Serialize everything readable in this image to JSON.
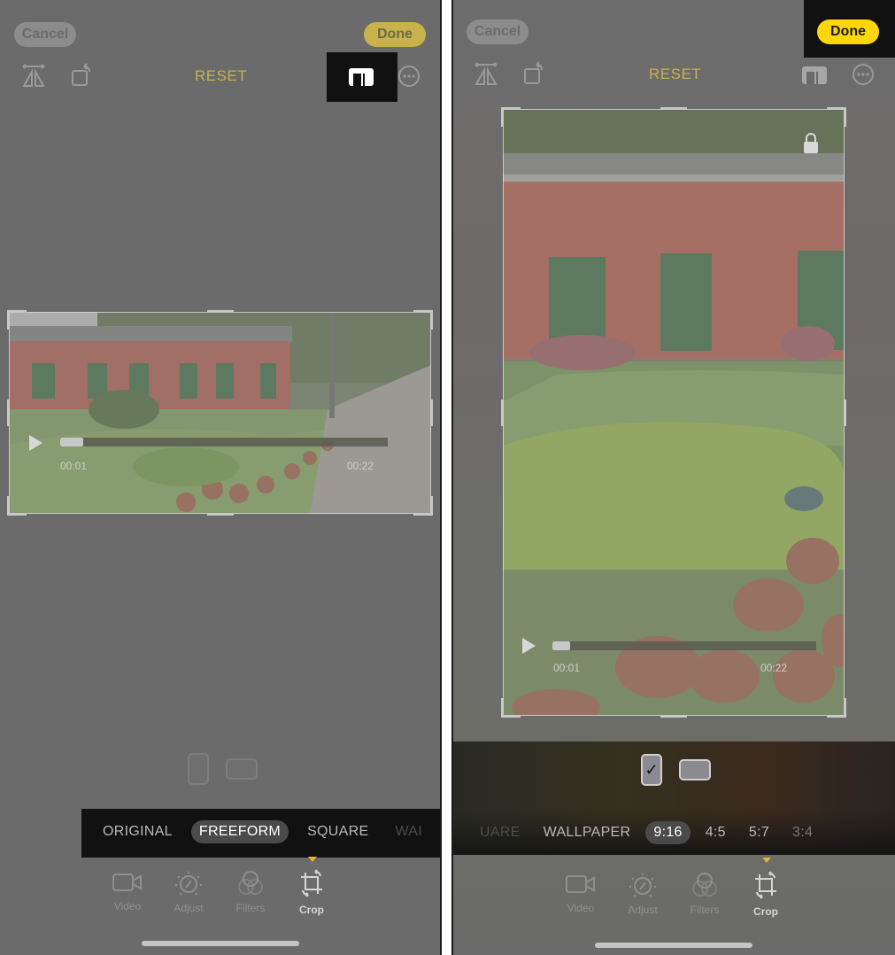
{
  "colors": {
    "accent_yellow": "#ffd60a",
    "accent_muted": "#c9b24a",
    "screen_bg": "#6b6b6b",
    "highlight_box": "#111111"
  },
  "left": {
    "cancel_label": "Cancel",
    "done_label": "Done",
    "reset_label": "RESET",
    "icons": {
      "flip": "flip-horizontal-icon",
      "rotate": "rotate-icon",
      "aspect": "aspect-ratio-icon",
      "more": "more-options-icon"
    },
    "highlighted": "aspect-ratio-icon",
    "video": {
      "current_time": "00:01",
      "end_time": "00:22",
      "progress_fraction": 0.05
    },
    "orientation": {
      "portrait_selected": false,
      "landscape_selected": false
    },
    "aspect_options": [
      {
        "label": "ORIGINAL",
        "selected": false
      },
      {
        "label": "FREEFORM",
        "selected": true
      },
      {
        "label": "SQUARE",
        "selected": false
      },
      {
        "label": "WAI",
        "selected": false
      }
    ],
    "tabs": [
      {
        "label": "Video",
        "icon": "video-camera-icon",
        "active": false
      },
      {
        "label": "Adjust",
        "icon": "adjust-dial-icon",
        "active": false
      },
      {
        "label": "Filters",
        "icon": "filters-icon",
        "active": false
      },
      {
        "label": "Crop",
        "icon": "crop-rotate-icon",
        "active": true
      }
    ]
  },
  "right": {
    "cancel_label": "Cancel",
    "done_label": "Done",
    "reset_label": "RESET",
    "highlighted": "done-button",
    "video": {
      "current_time": "00:01",
      "end_time": "00:22",
      "progress_fraction": 0.05
    },
    "orientation": {
      "portrait_selected": true,
      "landscape_selected": false,
      "check_glyph": "✓"
    },
    "aspect_options": [
      {
        "label": "UARE",
        "selected": false
      },
      {
        "label": "WALLPAPER",
        "selected": false
      },
      {
        "label": "9:16",
        "selected": true
      },
      {
        "label": "4:5",
        "selected": false
      },
      {
        "label": "5:7",
        "selected": false
      },
      {
        "label": "3:4",
        "selected": false
      }
    ],
    "tabs": [
      {
        "label": "Video",
        "icon": "video-camera-icon",
        "active": false
      },
      {
        "label": "Adjust",
        "icon": "adjust-dial-icon",
        "active": false
      },
      {
        "label": "Filters",
        "icon": "filters-icon",
        "active": false
      },
      {
        "label": "Crop",
        "icon": "crop-rotate-icon",
        "active": true
      }
    ]
  }
}
